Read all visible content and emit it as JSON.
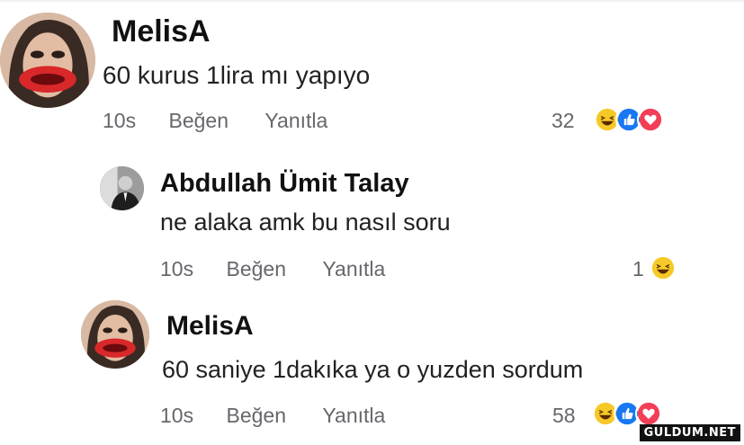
{
  "comments": [
    {
      "author": "MelisA",
      "text": "60 kurus 1lira mı yapıyo",
      "time": "10s",
      "like_label": "Beğen",
      "reply_label": "Yanıtla",
      "reaction_count": "32",
      "reactions": [
        "haha-icon",
        "like-icon",
        "love-icon"
      ]
    },
    {
      "author": "Abdullah Ümit Talay",
      "text": "ne alaka amk bu nasıl soru",
      "time": "10s",
      "like_label": "Beğen",
      "reply_label": "Yanıtla",
      "reaction_count": "1",
      "reactions": [
        "haha-icon"
      ]
    },
    {
      "author": "MelisA",
      "text": "60 saniye 1dakıka ya o yuzden sordum",
      "time": "10s",
      "like_label": "Beğen",
      "reply_label": "Yanıtla",
      "reaction_count": "58",
      "reactions": [
        "haha-icon",
        "like-icon",
        "love-icon"
      ]
    }
  ],
  "watermark": "GULDUM.NET",
  "colors": {
    "haha": "#f7c928",
    "like": "#1877f2",
    "love": "#f33e58",
    "meta": "#65676b"
  }
}
